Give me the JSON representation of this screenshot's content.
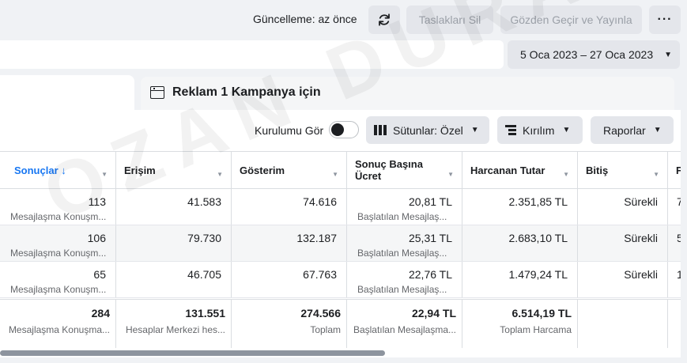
{
  "header": {
    "update_status": "Güncelleme: az önce",
    "delete_drafts_label": "Taslakları Sil",
    "review_publish_label": "Gözden Geçir ve Yayınla",
    "more_label": "···",
    "date_range": "5 Oca 2023 – 27 Oca 2023"
  },
  "panel": {
    "tab_title": "Reklam 1 Kampanya için"
  },
  "toolbar": {
    "setup_label": "Kurulumu Gör",
    "columns_label": "Sütunlar: Özel",
    "breakdown_label": "Kırılım",
    "reports_label": "Raporlar"
  },
  "table": {
    "columns": [
      "Sonuçlar ↓",
      "Erişim",
      "Gösterim",
      "Sonuç Başına Ücret",
      "Harcanan Tutar",
      "Bitiş",
      "F"
    ],
    "rows": [
      {
        "results": "113",
        "results_sub": "Mesajlaşma Konuşm...",
        "reach": "41.583",
        "impressions": "74.616",
        "cpr": "20,81 TL",
        "cpr_sub": "Başlatılan Mesajlaş...",
        "spend": "2.351,85 TL",
        "end": "Sürekli",
        "extra": "7"
      },
      {
        "results": "106",
        "results_sub": "Mesajlaşma Konuşm...",
        "reach": "79.730",
        "impressions": "132.187",
        "cpr": "25,31 TL",
        "cpr_sub": "Başlatılan Mesajlaş...",
        "spend": "2.683,10 TL",
        "end": "Sürekli",
        "extra": "5"
      },
      {
        "results": "65",
        "results_sub": "Mesajlaşma Konuşm...",
        "reach": "46.705",
        "impressions": "67.763",
        "cpr": "22,76 TL",
        "cpr_sub": "Başlatılan Mesajlaş...",
        "spend": "1.479,24 TL",
        "end": "Sürekli",
        "extra": "1"
      }
    ],
    "totals": {
      "results": "284",
      "results_sub": "Mesajlaşma Konuşma...",
      "reach": "131.551",
      "reach_sub": "Hesaplar Merkezi hes...",
      "impressions": "274.566",
      "impressions_sub": "Toplam",
      "cpr": "22,94 TL",
      "cpr_sub": "Başlatılan Mesajlaşma...",
      "spend": "6.514,19 TL",
      "spend_sub": "Toplam Harcama"
    }
  },
  "watermark": "OZAN DURAK",
  "colors": {
    "accent": "#1877f2",
    "button_bg": "#e4e6eb",
    "page_bg": "#f0f2f5"
  }
}
